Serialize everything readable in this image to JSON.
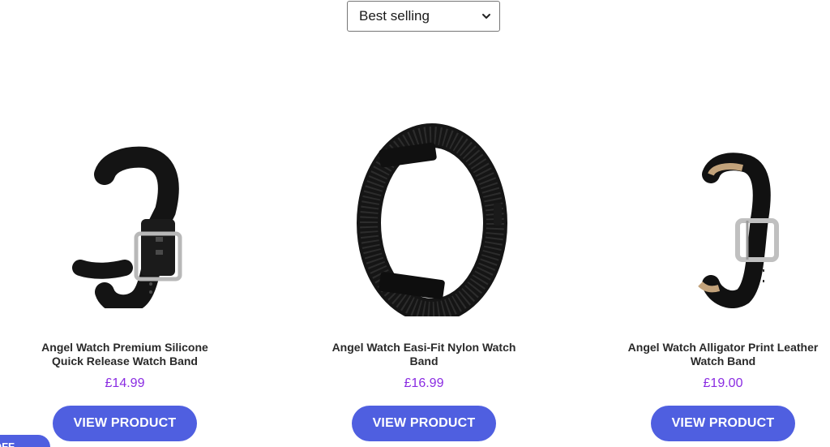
{
  "sort": {
    "selected": "Best selling"
  },
  "products": [
    {
      "name": "Angel Watch Premium Silicone Quick Release Watch Band",
      "price": "£14.99",
      "button": "VIEW PRODUCT"
    },
    {
      "name": "Angel Watch Easi-Fit Nylon Watch Band",
      "price": "£16.99",
      "button": "VIEW PRODUCT"
    },
    {
      "name": "Angel Watch Alligator Print Leather Watch Band",
      "price": "£19.00",
      "button": "VIEW PRODUCT"
    }
  ],
  "offer_tab": {
    "label": "OFF"
  },
  "colors": {
    "accent": "#4f5fe0",
    "price": "#8a2be2"
  },
  "icons": {
    "sort_chevron": "chevron-down-icon"
  }
}
